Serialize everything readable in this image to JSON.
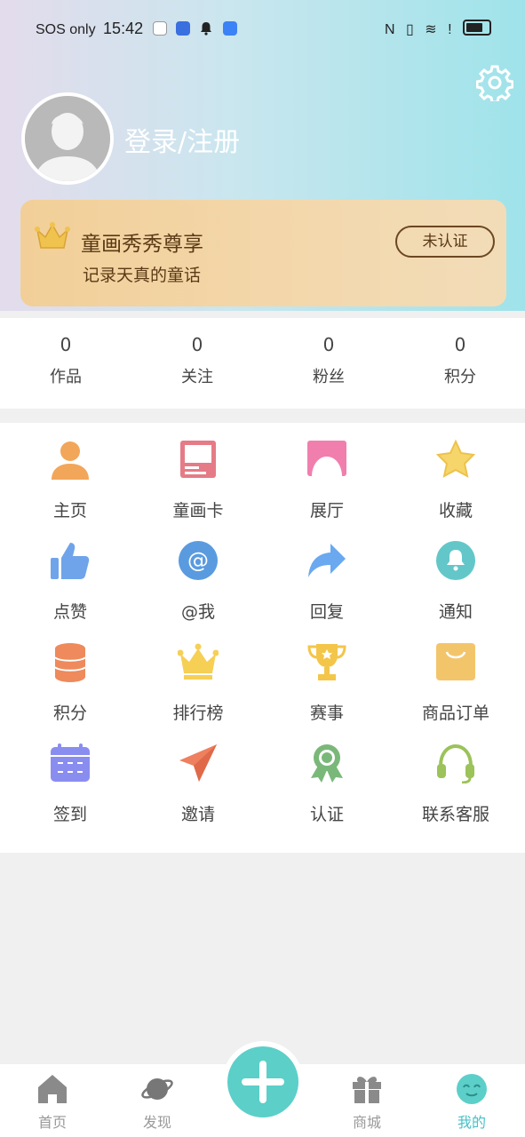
{
  "status_bar": {
    "carrier": "SOS only",
    "time": "15:42",
    "right_icons": [
      "nfc-icon",
      "vibrate-icon",
      "wifi-icon",
      "alert-icon",
      "battery-icon"
    ]
  },
  "profile": {
    "login_text": "登录/注册",
    "settings_icon": "gear-icon"
  },
  "vip_card": {
    "title": "童画秀秀尊享",
    "subtitle": "记录天真的童话",
    "status_button": "未认证"
  },
  "stats": [
    {
      "value": "0",
      "label": "作品"
    },
    {
      "value": "0",
      "label": "关注"
    },
    {
      "value": "0",
      "label": "粉丝"
    },
    {
      "value": "0",
      "label": "积分"
    }
  ],
  "menu": [
    {
      "label": "主页",
      "icon": "person-icon",
      "color": "#f2a65a"
    },
    {
      "label": "童画卡",
      "icon": "card-icon",
      "color": "#e57b86"
    },
    {
      "label": "展厅",
      "icon": "gallery-icon",
      "color": "#f07fae"
    },
    {
      "label": "收藏",
      "icon": "star-icon",
      "color": "#f6d66a"
    },
    {
      "label": "点赞",
      "icon": "thumbs-up-icon",
      "color": "#6fa4ea"
    },
    {
      "label": "@我",
      "icon": "at-icon",
      "color": "#5a9be0"
    },
    {
      "label": "回复",
      "icon": "reply-arrow-icon",
      "color": "#6aa8f0"
    },
    {
      "label": "通知",
      "icon": "bell-icon",
      "color": "#63c7c9"
    },
    {
      "label": "积分",
      "icon": "coins-icon",
      "color": "#ee8a5c"
    },
    {
      "label": "排行榜",
      "icon": "crown-icon",
      "color": "#f6cf55"
    },
    {
      "label": "赛事",
      "icon": "trophy-icon",
      "color": "#f3c64a"
    },
    {
      "label": "商品订单",
      "icon": "shopping-bag-icon",
      "color": "#f3c56b"
    },
    {
      "label": "签到",
      "icon": "calendar-icon",
      "color": "#8a8df0"
    },
    {
      "label": "邀请",
      "icon": "paper-plane-icon",
      "color": "#ee7f5f"
    },
    {
      "label": "认证",
      "icon": "badge-icon",
      "color": "#7ab87a"
    },
    {
      "label": "联系客服",
      "icon": "headset-icon",
      "color": "#9cc25a"
    }
  ],
  "tabbar": [
    {
      "label": "首页",
      "icon": "home-icon"
    },
    {
      "label": "发现",
      "icon": "planet-icon"
    },
    {
      "label": "商城",
      "icon": "gift-icon"
    },
    {
      "label": "我的",
      "icon": "smile-face-icon",
      "active": true
    }
  ],
  "center_button_icon": "plus-icon",
  "colors": {
    "accent": "#46c2c7",
    "plus_button": "#5ccfc9"
  }
}
